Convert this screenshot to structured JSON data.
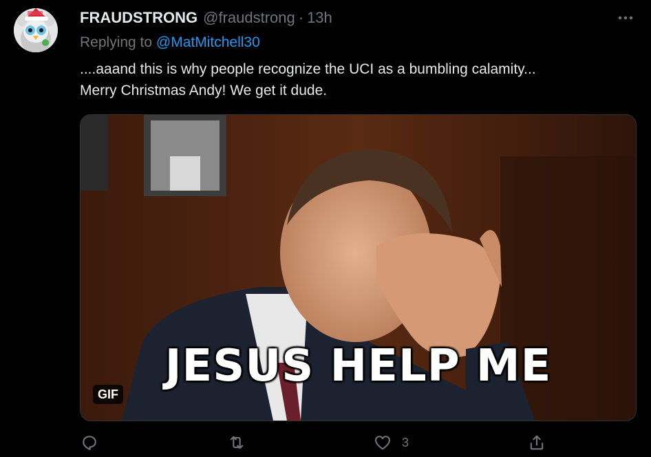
{
  "tweet": {
    "display_name": "FRAUDSTRONG",
    "handle": "@fraudstrong",
    "separator": "·",
    "time": "13h",
    "replying_prefix": "Replying to ",
    "replying_to": "@MatMitchell30",
    "text_lines": [
      "....aaand this is why people recognize the UCI as a bumbling calamity...",
      "Merry Christmas Andy! We get it dude."
    ],
    "media": {
      "caption": "JESUS HELP ME",
      "badge": "GIF"
    },
    "actions": {
      "reply_icon": "reply-icon",
      "retweet_icon": "retweet-icon",
      "like_icon": "heart-icon",
      "like_count": "3",
      "share_icon": "share-icon"
    }
  },
  "colors": {
    "background": "#000000",
    "text": "#e7e9ea",
    "secondary": "#71767b",
    "link": "#1d9bf0"
  }
}
